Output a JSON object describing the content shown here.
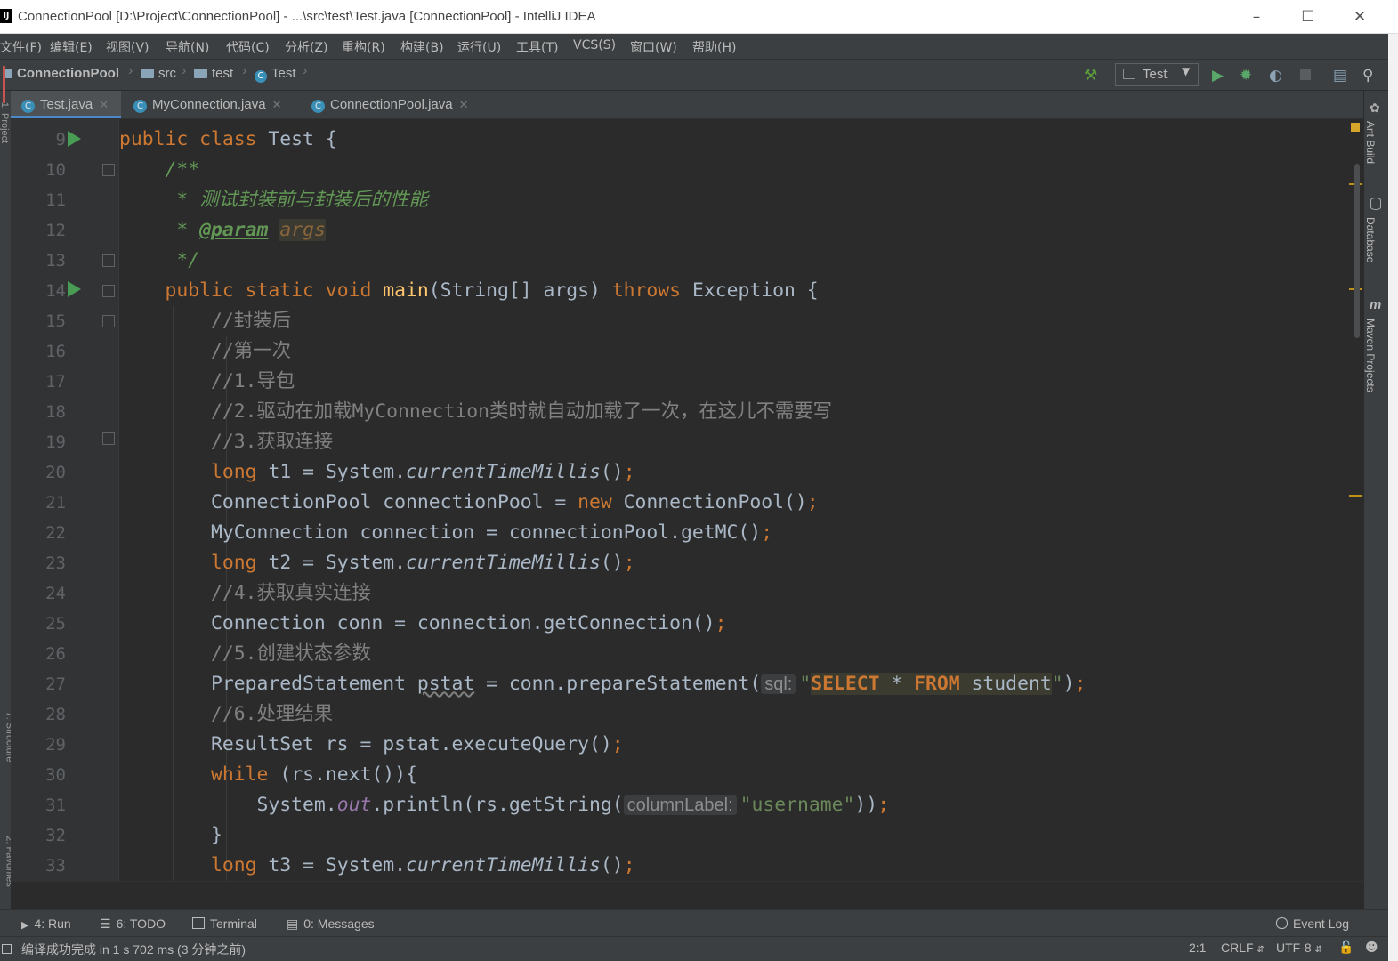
{
  "window": {
    "title": "ConnectionPool [D:\\Project\\ConnectionPool] - ...\\src\\test\\Test.java [ConnectionPool] - IntelliJ IDEA",
    "app_icon": "IJ"
  },
  "menu": [
    "文件(F)",
    "编辑(E)",
    "视图(V)",
    "导航(N)",
    "代码(C)",
    "分析(Z)",
    "重构(R)",
    "构建(B)",
    "运行(U)",
    "工具(T)",
    "VCS(S)",
    "窗口(W)",
    "帮助(H)"
  ],
  "breadcrumb": {
    "project": "ConnectionPool",
    "src": "src",
    "test": "test",
    "cls": "Test"
  },
  "run_config": {
    "label": "Test"
  },
  "tabs": [
    {
      "label": "Test.java",
      "active": true
    },
    {
      "label": "MyConnection.java",
      "active": false
    },
    {
      "label": "ConnectionPool.java",
      "active": false
    }
  ],
  "right_tools": [
    "Ant Build",
    "Database",
    "Maven Projects"
  ],
  "left_tools": [
    "1: Project",
    "7: Structure",
    "2: Favorites"
  ],
  "editor": {
    "line_numbers": [
      "9",
      "10",
      "11",
      "12",
      "13",
      "14",
      "15",
      "16",
      "17",
      "18",
      "19",
      "20",
      "21",
      "22",
      "23",
      "24",
      "25",
      "26",
      "27",
      "28",
      "29",
      "30",
      "31",
      "32",
      "33"
    ],
    "comments": {
      "c15": "//封装后",
      "c16": "//第一次",
      "c17": "//1.导包",
      "c18": "//2.驱动在加载MyConnection类时就自动加载了一次，在这儿不需要写",
      "c19": "//3.获取连接",
      "c24": "//4.获取真实连接",
      "c26": "//5.创建状态参数",
      "c28": "//6.处理结果"
    },
    "doc_text": "测试封装前与封装后的性能",
    "hints": {
      "sql": "sql:",
      "columnLabel": "columnLabel:"
    },
    "strings": {
      "sql_select": "SELECT",
      "sql_star": " * ",
      "sql_from": "FROM",
      "sql_table": " student",
      "username": "\"username\""
    }
  },
  "bottom_tools": {
    "run": "4: Run",
    "todo": "6: TODO",
    "terminal": "Terminal",
    "messages": "0: Messages",
    "event_log": "Event Log"
  },
  "status": {
    "message": "编译成功完成 in 1 s 702 ms (3 分钟之前)",
    "position": "2:1",
    "line_sep": "CRLF",
    "encoding": "UTF-8"
  }
}
